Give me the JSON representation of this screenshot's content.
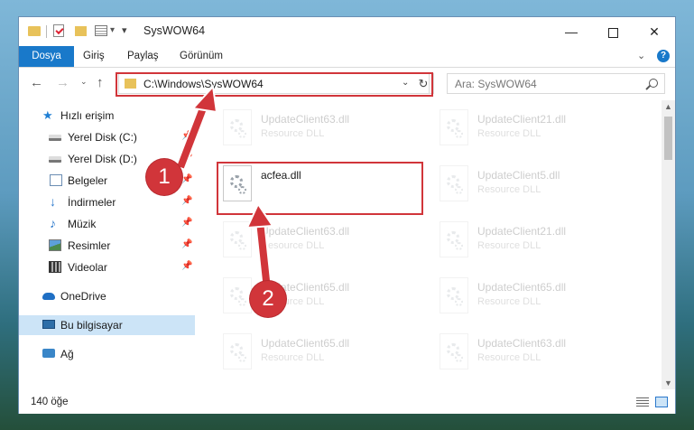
{
  "window": {
    "title": "SysWOW64",
    "controls": {
      "minimize": "—",
      "maximize": "",
      "close": "✕"
    }
  },
  "ribbon": {
    "tabs": [
      "Dosya",
      "Giriş",
      "Paylaş",
      "Görünüm"
    ],
    "expand_glyph": "⌄",
    "help_glyph": "?"
  },
  "address": {
    "path": "C:\\Windows\\SysWOW64",
    "dropdown_glyph": "⌄",
    "refresh_glyph": "↻",
    "search_placeholder": "Ara: SysWOW64"
  },
  "nav_glyphs": {
    "back": "←",
    "forward": "→",
    "recent": "⌄",
    "up": "↑"
  },
  "sidebar": {
    "items": [
      {
        "label": "Hızlı erişim",
        "icon": "star-icon"
      },
      {
        "label": "Yerel Disk (C:)",
        "icon": "drive-icon",
        "pin": "📌"
      },
      {
        "label": "Yerel Disk (D:)",
        "icon": "drive-icon",
        "pin": "📌"
      },
      {
        "label": "Belgeler",
        "icon": "documents-icon",
        "pin": "📌"
      },
      {
        "label": "İndirmeler",
        "icon": "download-icon",
        "pin": "📌"
      },
      {
        "label": "Müzik",
        "icon": "music-icon",
        "pin": "📌"
      },
      {
        "label": "Resimler",
        "icon": "pictures-icon",
        "pin": "📌"
      },
      {
        "label": "Videolar",
        "icon": "video-icon",
        "pin": "📌"
      },
      {
        "label": "OneDrive",
        "icon": "onedrive-icon"
      },
      {
        "label": "Bu bilgisayar",
        "icon": "computer-icon",
        "selected": true
      },
      {
        "label": "Ağ",
        "icon": "network-icon"
      }
    ]
  },
  "files": [
    {
      "name": "UpdateClient63.dll",
      "desc": "Resource DLL",
      "faded": true
    },
    {
      "name": "UpdateClient21.dll",
      "desc": "Resource DLL",
      "faded": true
    },
    {
      "name": "acfea.dll",
      "desc": "",
      "faded": false
    },
    {
      "name": "UpdateClient5.dll",
      "desc": "Resource DLL",
      "faded": true
    },
    {
      "name": "UpdateClient63.dll",
      "desc": "Resource DLL",
      "faded": true
    },
    {
      "name": "UpdateClient21.dll",
      "desc": "Resource DLL",
      "faded": true
    },
    {
      "name": "UpdateClient65.dll",
      "desc": "Resource DLL",
      "faded": true
    },
    {
      "name": "UpdateClient65.dll",
      "desc": "Resource DLL",
      "faded": true
    },
    {
      "name": "UpdateClient65.dll",
      "desc": "Resource DLL",
      "faded": true
    },
    {
      "name": "UpdateClient63.dll",
      "desc": "Resource DLL",
      "faded": true
    }
  ],
  "status": {
    "item_count": "140 öğe"
  },
  "scroll": {
    "up": "▲",
    "down": "▼"
  },
  "callouts": {
    "one": "1",
    "two": "2"
  },
  "colors": {
    "accent": "#1979ca",
    "highlight": "#d1353a",
    "selected_bg": "#cce4f7"
  }
}
